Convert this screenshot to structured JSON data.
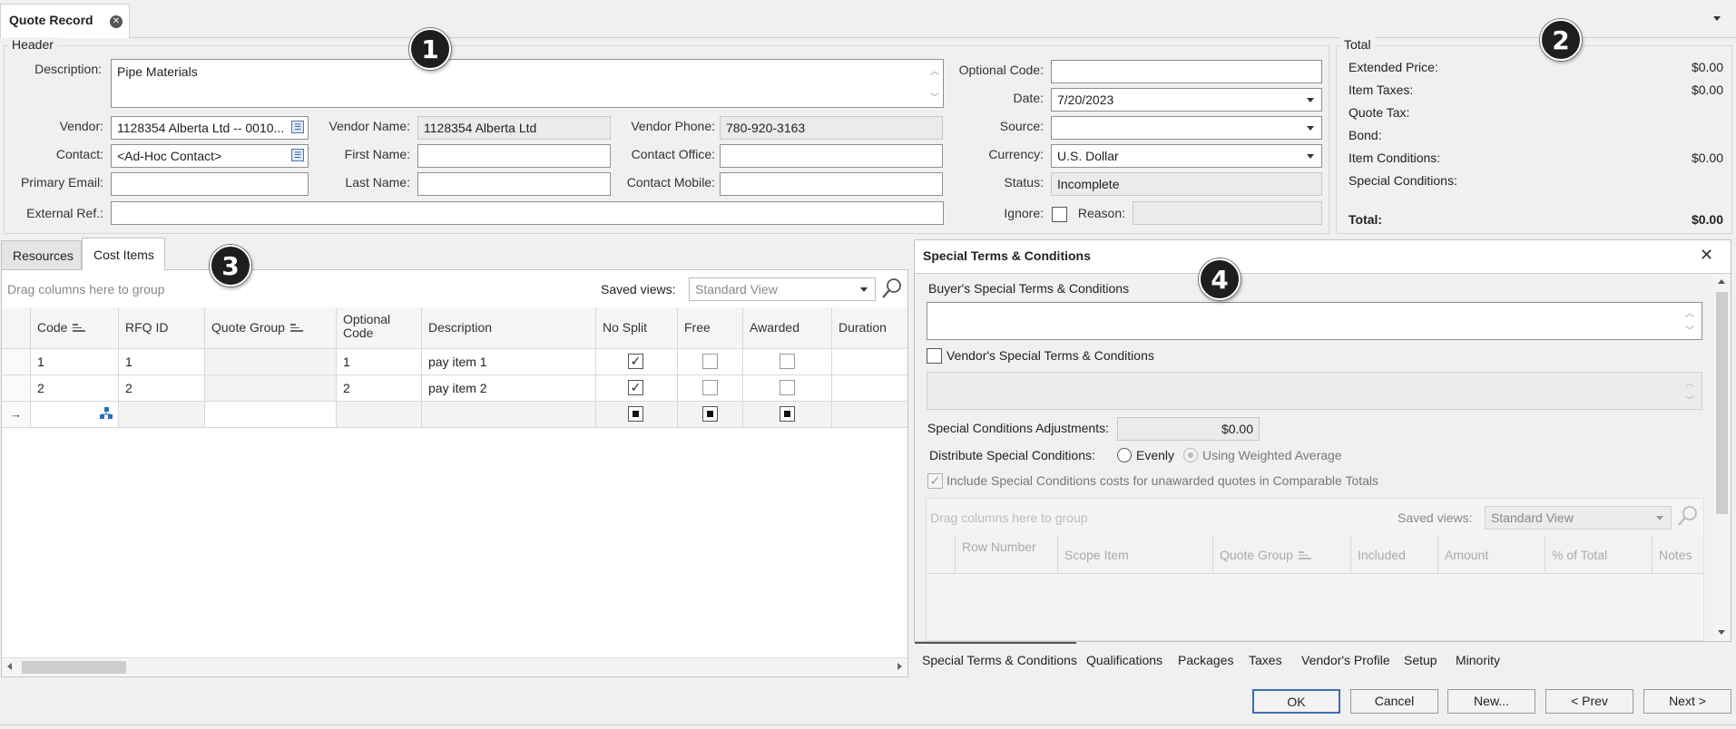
{
  "window": {
    "title_tab": "Quote Record"
  },
  "header_group": {
    "title": "Header",
    "description_label": "Description:",
    "description_value": "Pipe Materials",
    "vendor_label": "Vendor:",
    "vendor_value": "1128354 Alberta Ltd -- 0010...",
    "vendor_name_label": "Vendor Name:",
    "vendor_name_value": "1128354 Alberta Ltd",
    "vendor_phone_label": "Vendor Phone:",
    "vendor_phone_value": "780-920-3163",
    "contact_label": "Contact:",
    "contact_value": "<Ad-Hoc Contact>",
    "first_name_label": "First Name:",
    "first_name_value": "",
    "contact_office_label": "Contact Office:",
    "contact_office_value": "",
    "primary_email_label": "Primary Email:",
    "primary_email_value": "",
    "last_name_label": "Last Name:",
    "last_name_value": "",
    "contact_mobile_label": "Contact Mobile:",
    "contact_mobile_value": "",
    "external_ref_label": "External Ref.:",
    "external_ref_value": "",
    "optional_code_label": "Optional Code:",
    "optional_code_value": "",
    "date_label": "Date:",
    "date_value": "7/20/2023",
    "source_label": "Source:",
    "source_value": "",
    "currency_label": "Currency:",
    "currency_value": "U.S. Dollar",
    "status_label": "Status:",
    "status_value": "Incomplete",
    "ignore_label": "Ignore:",
    "reason_label": "Reason:",
    "reason_value": ""
  },
  "total_group": {
    "title": "Total",
    "extended_price_label": "Extended Price:",
    "extended_price_value": "$0.00",
    "item_taxes_label": "Item Taxes:",
    "item_taxes_value": "$0.00",
    "quote_tax_label": "Quote Tax:",
    "bond_label": "Bond:",
    "item_conditions_label": "Item Conditions:",
    "item_conditions_value": "$0.00",
    "special_conditions_label": "Special Conditions:",
    "total_label": "Total:",
    "total_value": "$0.00"
  },
  "badges": [
    "1",
    "2",
    "3",
    "4"
  ],
  "left_panel": {
    "tabs": [
      "Resources",
      "Cost Items"
    ],
    "group_hint": "Drag columns here to group",
    "saved_views_label": "Saved views:",
    "saved_views_value": "Standard View",
    "columns": [
      "Code",
      "RFQ ID",
      "Quote Group",
      "Optional Code",
      "Description",
      "No Split",
      "Free",
      "Awarded",
      "Duration"
    ],
    "rows": [
      {
        "code": "1",
        "rfq": "1",
        "group": "",
        "optional": "1",
        "description": "pay item 1",
        "no_split": "✓",
        "free": "",
        "awarded": ""
      },
      {
        "code": "2",
        "rfq": "2",
        "group": "",
        "optional": "2",
        "description": "pay item 2",
        "no_split": "✓",
        "free": "",
        "awarded": ""
      }
    ]
  },
  "right_panel": {
    "title": "Special Terms & Conditions",
    "buyers_label": "Buyer's Special Terms & Conditions",
    "vendors_label": "Vendor's Special Terms & Conditions",
    "adjustments_label": "Special Conditions Adjustments:",
    "adjustments_value": "$0.00",
    "distribute_label": "Distribute Special Conditions:",
    "evenly_label": "Evenly",
    "weighted_label": "Using Weighted Average",
    "include_label": "Include Special Conditions costs for unawarded quotes in Comparable Totals",
    "group_hint": "Drag columns here to group",
    "saved_views_label": "Saved views:",
    "saved_views_value": "Standard View",
    "columns": [
      "Row Number",
      "Scope Item",
      "Quote Group",
      "Included",
      "Amount",
      "% of Total",
      "Notes"
    ],
    "bottom_tabs": [
      "Special Terms & Conditions",
      "Qualifications",
      "Packages",
      "Taxes",
      "Vendor's Profile",
      "Setup",
      "Minority"
    ]
  },
  "footer": {
    "ok": "OK",
    "cancel": "Cancel",
    "new": "New...",
    "prev": "< Prev",
    "next": "Next >"
  }
}
